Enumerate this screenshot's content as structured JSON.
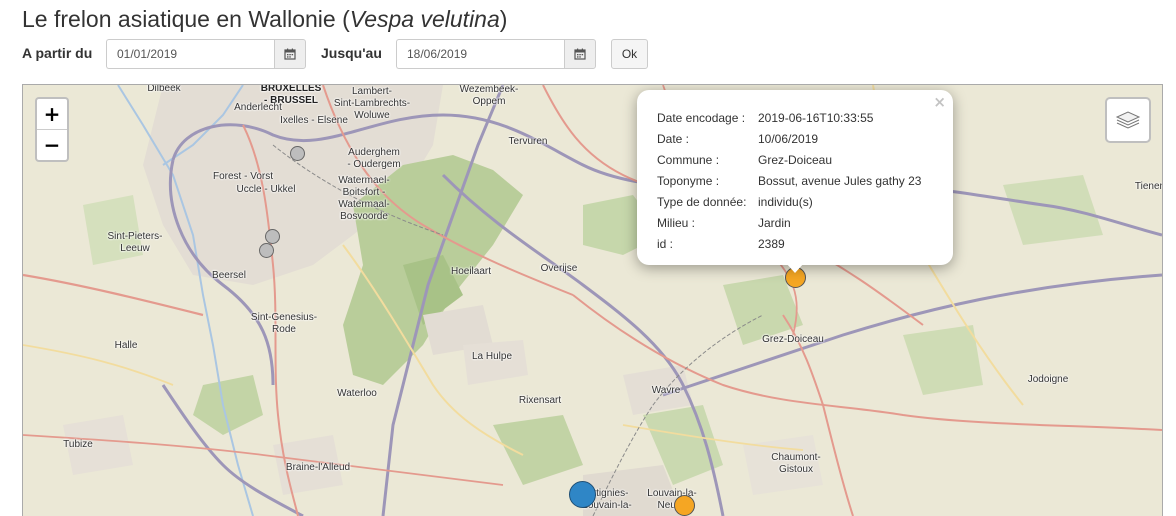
{
  "page": {
    "title_main": "Le frelon asiatique en Wallonie (",
    "title_species": "Vespa velutina",
    "title_end": ")"
  },
  "filter": {
    "from_label": "A partir du",
    "from_value": "01/01/2019",
    "to_label": "Jusqu'au",
    "to_value": "18/06/2019",
    "ok_label": "Ok",
    "calendar_icon": "calendar-icon"
  },
  "map": {
    "zoom_in": "+",
    "zoom_out": "−",
    "layers_icon": "layers-icon",
    "places": [
      {
        "name": "Dilbeek",
        "kind": "town"
      },
      {
        "name": "BRUXELLES\n- BRUSSEL",
        "kind": "city"
      },
      {
        "name": "Anderlecht",
        "kind": "town"
      },
      {
        "name": "Lambert-\nSint-Lambrechts-\nWoluwe",
        "kind": "town"
      },
      {
        "name": "Wezembeek-\nOppem",
        "kind": "town"
      },
      {
        "name": "Ixelles - Elsene",
        "kind": "town"
      },
      {
        "name": "Tervuren",
        "kind": "town"
      },
      {
        "name": "Auderghem\n- Oudergem",
        "kind": "town"
      },
      {
        "name": "Forest - Vorst",
        "kind": "town"
      },
      {
        "name": "Uccle - Ukkel",
        "kind": "town"
      },
      {
        "name": "Watermael-\nBoitsfort -\nWatermaal-\nBosvoorde",
        "kind": "town"
      },
      {
        "name": "Sint-Pieters-\nLeeuw",
        "kind": "town"
      },
      {
        "name": "Beersel",
        "kind": "town"
      },
      {
        "name": "Hoeilaart",
        "kind": "town"
      },
      {
        "name": "Overijse",
        "kind": "town"
      },
      {
        "name": "Sint-Genesius-\nRode",
        "kind": "town"
      },
      {
        "name": "Halle",
        "kind": "town"
      },
      {
        "name": "La Hulpe",
        "kind": "town"
      },
      {
        "name": "Grez-Doiceau",
        "kind": "town"
      },
      {
        "name": "Waterloo",
        "kind": "town"
      },
      {
        "name": "Wavre",
        "kind": "town"
      },
      {
        "name": "Rixensart",
        "kind": "town"
      },
      {
        "name": "Jodoigne",
        "kind": "town"
      },
      {
        "name": "Tubize",
        "kind": "town"
      },
      {
        "name": "Braine-l'Alleud",
        "kind": "town"
      },
      {
        "name": "Chaumont-\nGistoux",
        "kind": "town"
      },
      {
        "name": "Ottignies-\nLouvain-la-",
        "kind": "town"
      },
      {
        "name": "Louvain-la-\nNeuve",
        "kind": "town"
      },
      {
        "name": "Tienen",
        "kind": "town"
      }
    ],
    "markers": [
      {
        "type": "gray",
        "color": "#bdbdbd"
      },
      {
        "type": "gray",
        "color": "#bdbdbd"
      },
      {
        "type": "gray",
        "color": "#bdbdbd"
      },
      {
        "type": "orange",
        "color": "#f5a623"
      },
      {
        "type": "blue",
        "color": "#2f86c6"
      },
      {
        "type": "orange",
        "color": "#f5a623"
      }
    ]
  },
  "popup": {
    "close": "×",
    "rows": [
      {
        "key": "Date encodage :",
        "value": "2019-06-16T10:33:55"
      },
      {
        "key": "Date :",
        "value": "10/06/2019"
      },
      {
        "key": "Commune :",
        "value": "Grez-Doiceau"
      },
      {
        "key": "Toponyme :",
        "value": "Bossut, avenue Jules gathy 23"
      },
      {
        "key": "Type de donnée:",
        "value": "individu(s)"
      },
      {
        "key": "Milieu :",
        "value": "Jardin"
      },
      {
        "key": "id :",
        "value": "2389"
      }
    ]
  }
}
